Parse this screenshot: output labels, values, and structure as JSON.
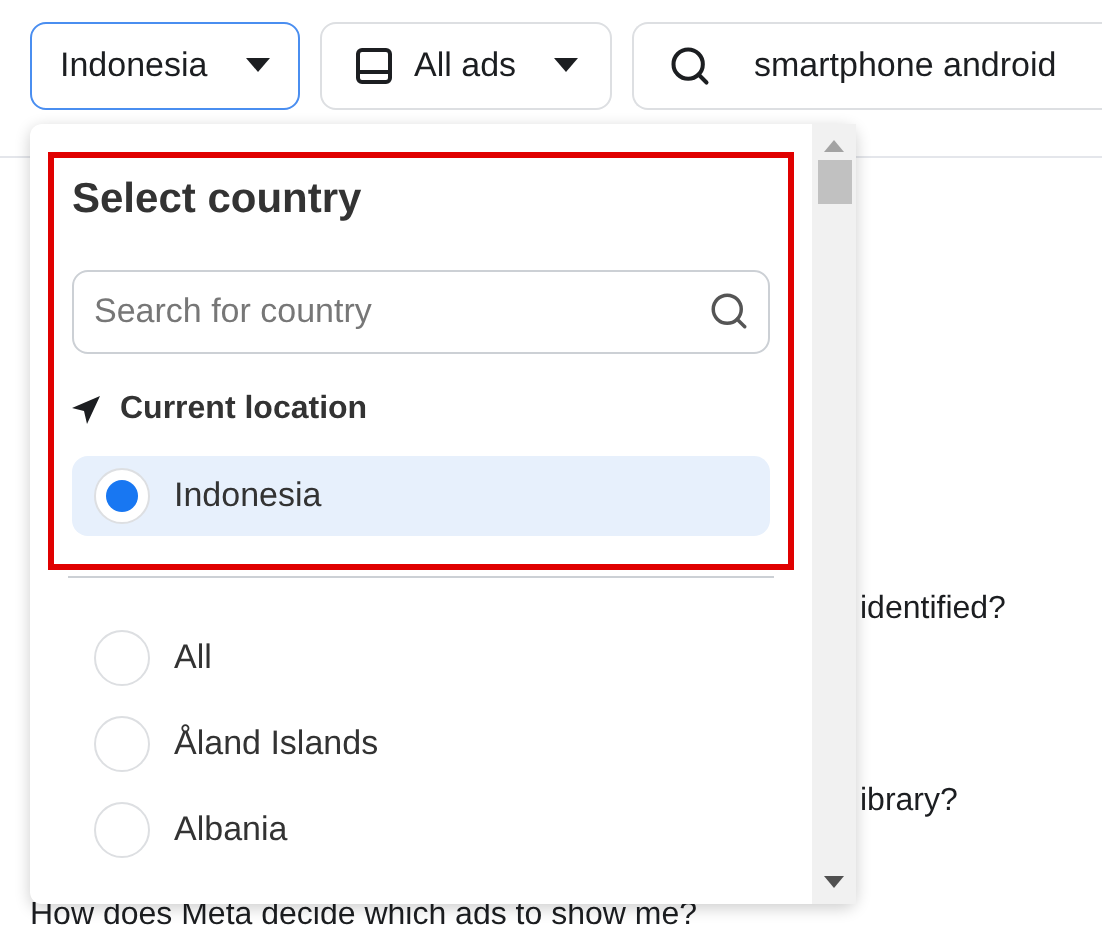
{
  "toolbar": {
    "country_button": "Indonesia",
    "ad_type_button": "All ads",
    "search": {
      "value": "smartphone android"
    }
  },
  "background_texts": [
    "identified?",
    "ibrary?",
    "How does Meta decide which ads to show me?"
  ],
  "dropdown": {
    "title": "Select country",
    "search": {
      "placeholder": "Search for country"
    },
    "current_location_label": "Current location",
    "current": [
      {
        "label": "Indonesia",
        "selected": true
      }
    ],
    "options": [
      {
        "label": "All",
        "selected": false
      },
      {
        "label": "Åland Islands",
        "selected": false
      },
      {
        "label": "Albania",
        "selected": false
      }
    ]
  }
}
